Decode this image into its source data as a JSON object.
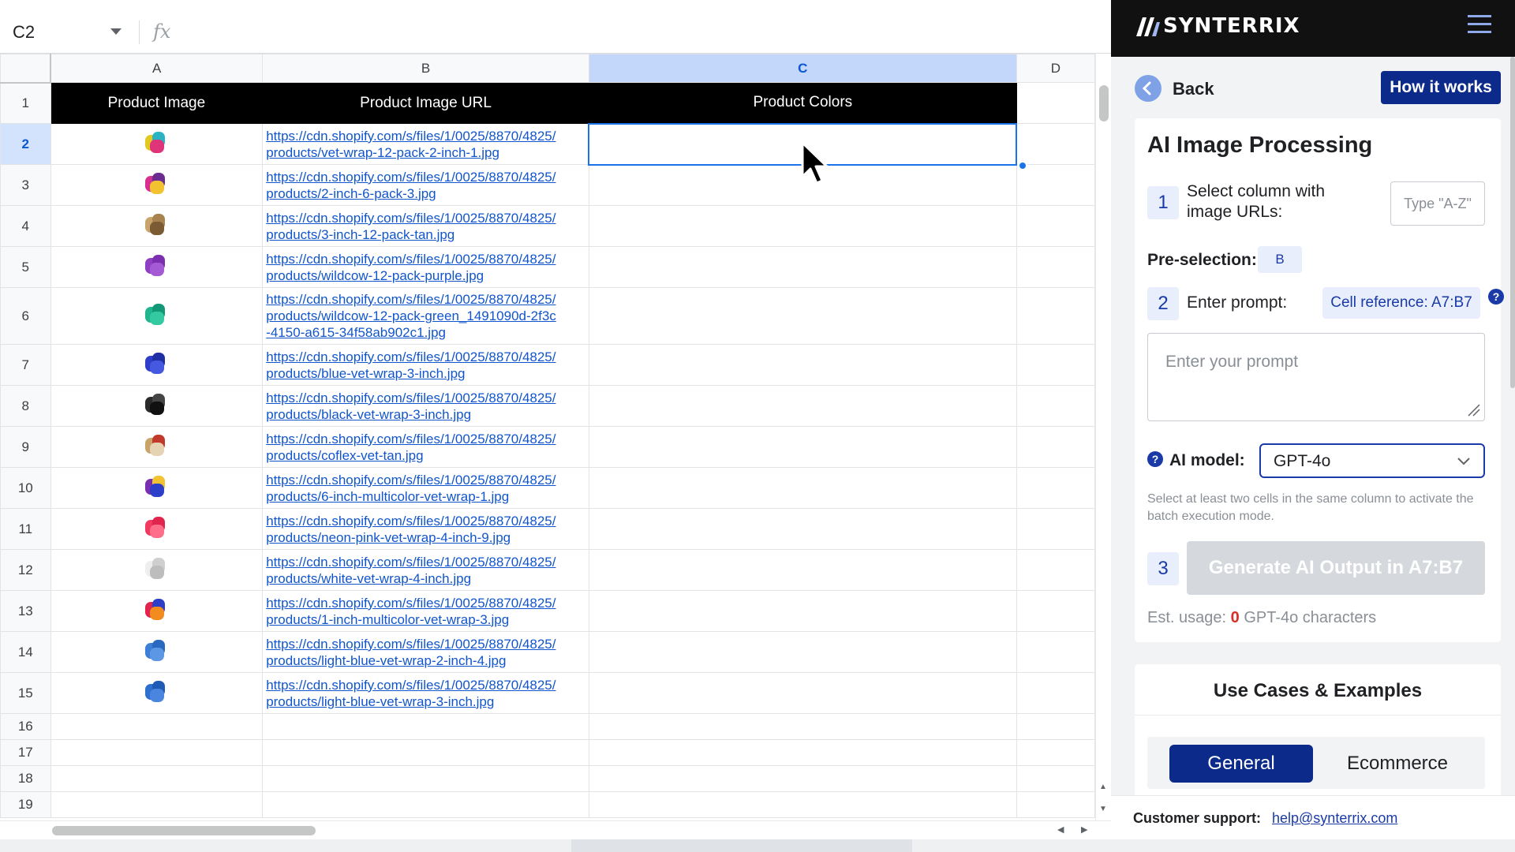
{
  "spreadsheet": {
    "name_box": "C2",
    "formula_icon": "fx",
    "columns": [
      "A",
      "B",
      "C",
      "D"
    ],
    "selected_column": "C",
    "selected_row": "2",
    "header_row": {
      "row_number": "1",
      "cells": [
        "Product Image",
        "Product Image URL",
        "Product Colors"
      ]
    },
    "rows": [
      {
        "row_number": "2",
        "thumb_colors": [
          "#e3c91f",
          "#2bb3c4",
          "#e0347a"
        ],
        "url": "https://cdn.shopify.com/s/files/1/0025/8870/4825/\nproducts/vet-wrap-12-pack-2-inch-1.jpg"
      },
      {
        "row_number": "3",
        "thumb_colors": [
          "#d62f8f",
          "#6a2c91",
          "#f2c230"
        ],
        "url": "https://cdn.shopify.com/s/files/1/0025/8870/4825/\nproducts/2-inch-6-pack-3.jpg"
      },
      {
        "row_number": "4",
        "thumb_colors": [
          "#c9a46a",
          "#a8824f",
          "#7a5b33"
        ],
        "url": "https://cdn.shopify.com/s/files/1/0025/8870/4825/\nproducts/3-inch-12-pack-tan.jpg"
      },
      {
        "row_number": "5",
        "thumb_colors": [
          "#8e3fc2",
          "#7b2fb0",
          "#a45ad4"
        ],
        "url": "https://cdn.shopify.com/s/files/1/0025/8870/4825/\nproducts/wildcow-12-pack-purple.jpg"
      },
      {
        "row_number": "6",
        "thumb_colors": [
          "#20b58f",
          "#129876",
          "#35c9a1"
        ],
        "url": "https://cdn.shopify.com/s/files/1/0025/8870/4825/\nproducts/wildcow-12-pack-green_1491090d-2f3c\n-4150-a615-34f58ab902c1.jpg"
      },
      {
        "row_number": "7",
        "thumb_colors": [
          "#2d3fc8",
          "#1f2ea3",
          "#4459e0"
        ],
        "url": "https://cdn.shopify.com/s/files/1/0025/8870/4825/\nproducts/blue-vet-wrap-3-inch.jpg"
      },
      {
        "row_number": "8",
        "thumb_colors": [
          "#2a2a2a",
          "#444444",
          "#111111"
        ],
        "url": "https://cdn.shopify.com/s/files/1/0025/8870/4825/\nproducts/black-vet-wrap-3-inch.jpg"
      },
      {
        "row_number": "9",
        "thumb_colors": [
          "#c9a46a",
          "#c0392b",
          "#e6d3b3"
        ],
        "url": "https://cdn.shopify.com/s/files/1/0025/8870/4825/\nproducts/coflex-vet-tan.jpg"
      },
      {
        "row_number": "10",
        "thumb_colors": [
          "#7b2fb0",
          "#f2c230",
          "#2d3fc8"
        ],
        "url": "https://cdn.shopify.com/s/files/1/0025/8870/4825/\nproducts/6-inch-multicolor-vet-wrap-1.jpg"
      },
      {
        "row_number": "11",
        "thumb_colors": [
          "#f03a5f",
          "#e0244d",
          "#ff6f8a"
        ],
        "url": "https://cdn.shopify.com/s/files/1/0025/8870/4825/\nproducts/neon-pink-vet-wrap-4-inch-9.jpg"
      },
      {
        "row_number": "12",
        "thumb_colors": [
          "#eeeeee",
          "#cfcfcf",
          "#bdbdbd"
        ],
        "url": "https://cdn.shopify.com/s/files/1/0025/8870/4825/\nproducts/white-vet-wrap-4-inch.jpg"
      },
      {
        "row_number": "13",
        "thumb_colors": [
          "#e0244d",
          "#2d3fc8",
          "#f28c1e"
        ],
        "url": "https://cdn.shopify.com/s/files/1/0025/8870/4825/\nproducts/1-inch-multicolor-vet-wrap-3.jpg"
      },
      {
        "row_number": "14",
        "thumb_colors": [
          "#3d7fd6",
          "#2a69c0",
          "#5c97e6"
        ],
        "url": "https://cdn.shopify.com/s/files/1/0025/8870/4825/\nproducts/light-blue-vet-wrap-2-inch-4.jpg"
      },
      {
        "row_number": "15",
        "thumb_colors": [
          "#2f6fcf",
          "#1f5bb5",
          "#4a86e0"
        ],
        "url": "https://cdn.shopify.com/s/files/1/0025/8870/4825/\nproducts/light-blue-vet-wrap-3-inch.jpg"
      }
    ],
    "empty_rows": [
      "16",
      "17",
      "18",
      "19"
    ]
  },
  "panel": {
    "brand": "SYNTERRIX",
    "back_label": "Back",
    "how_label": "How it works",
    "card_title": "AI Image Processing",
    "step1_number": "1",
    "step1_label": "Select column with\nimage URLs:",
    "column_input_placeholder": "Type \"A-Z\"",
    "preselection_label": "Pre-selection:",
    "preselection_value": "B",
    "step2_number": "2",
    "step2_label": "Enter prompt:",
    "cell_reference": "Cell reference: A7:B7",
    "prompt_placeholder": "Enter your prompt",
    "model_label": "AI model:",
    "model_value": "GPT-4o",
    "batch_hint": "Select at least two cells in the same column to activate the batch execution mode.",
    "step3_number": "3",
    "generate_label": "Generate AI Output in A7:B7",
    "usage_prefix": "Est. usage:",
    "usage_count": "0",
    "usage_suffix": "GPT-4o characters",
    "uses_title": "Use Cases & Examples",
    "tab_general": "General",
    "tab_ecommerce": "Ecommerce",
    "support_label": "Customer support:",
    "support_email": "help@synterrix.com",
    "colors": {
      "brand_navy": "#0b2a8a",
      "selection_blue": "#1a73e8",
      "usage_red": "#d93025"
    }
  }
}
